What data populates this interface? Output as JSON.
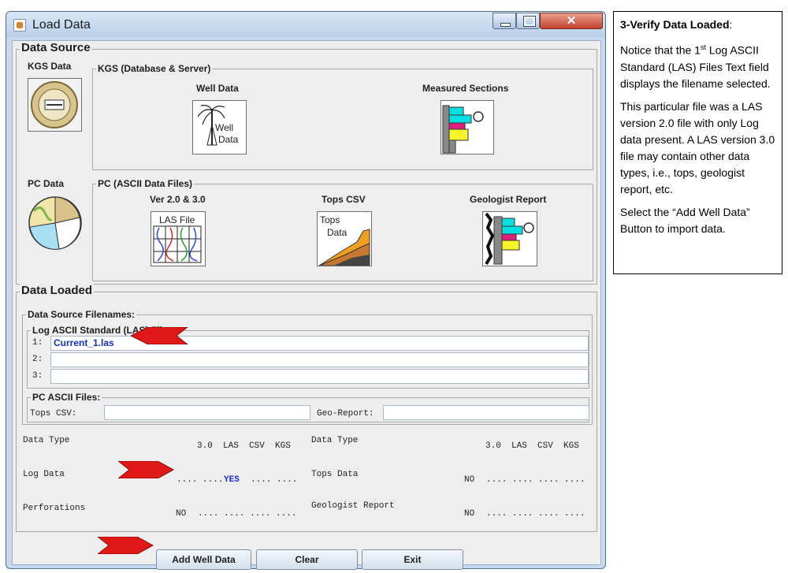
{
  "window": {
    "title": "Load Data",
    "close_glyph": "✕"
  },
  "data_source": {
    "legend": "Data Source",
    "kgs_label": "KGS Data",
    "kgs_group": "KGS (Database & Server)",
    "well_data": "Well Data",
    "well_icon_text": [
      "Well",
      "Data"
    ],
    "measured_sections": "Measured Sections",
    "pc_label": "PC Data",
    "pc_group": "PC (ASCII Data Files)",
    "ver": "Ver 2.0 & 3.0",
    "las_icon_text": "LAS File",
    "tops_csv": "Tops CSV",
    "tops_icon_text": [
      "Tops",
      "Data"
    ],
    "geologist_report": "Geologist Report"
  },
  "data_loaded": {
    "legend": "Data Loaded",
    "filenames_group": "Data Source Filenames:",
    "las_group": "Log ASCII Standard (LAS) Files:",
    "las_rows": [
      {
        "num": "1:",
        "value": "Current_1.las"
      },
      {
        "num": "2:",
        "value": ""
      },
      {
        "num": "3:",
        "value": ""
      }
    ],
    "pc_ascii_group": "PC ASCII Files:",
    "tops_csv_label": "Tops CSV:",
    "tops_csv_value": "",
    "geo_report_label": "Geo-Report:",
    "geo_report_value": ""
  },
  "status": {
    "left_header": {
      "type": "Data Type",
      "cols": "3.0  LAS  CSV  KGS"
    },
    "right_header": {
      "type": "Data Type",
      "cols": "3.0  LAS  CSV  KGS"
    },
    "log_data": {
      "label": "Log Data",
      "dots_a": ".... ....",
      "value": "YES",
      "dots_b": ".... ...."
    },
    "perforations": {
      "label": "Perforations",
      "value": "NO",
      "dots": ".... .... .... ...."
    },
    "tops_data": {
      "label": "Tops Data",
      "value": "NO",
      "dots": ".... .... .... ...."
    },
    "geologist_report": {
      "label": "Geologist Report",
      "value": "NO",
      "dots": ".... .... .... ...."
    }
  },
  "buttons": {
    "add": "Add Well Data",
    "clear": "Clear",
    "exit": "Exit"
  },
  "instructions": {
    "heading": "3-Verify Data Loaded",
    "heading_suffix": ":",
    "p1_a": "Notice that the 1",
    "p1_sup": "st",
    "p1_b": " Log ASCII Standard (LAS) Files Text field displays the filename selected.",
    "p2": "This particular file was a LAS version 2.0 file with only Log data present. A LAS version 3.0 file may contain other data types, i.e., tops, geologist report, etc.",
    "p3": "Select the “Add Well Data” Button to import data."
  },
  "colors": {
    "arrow": "#e01818",
    "accent_text": "#1530c8",
    "window_frame": "#c6d9ef"
  }
}
